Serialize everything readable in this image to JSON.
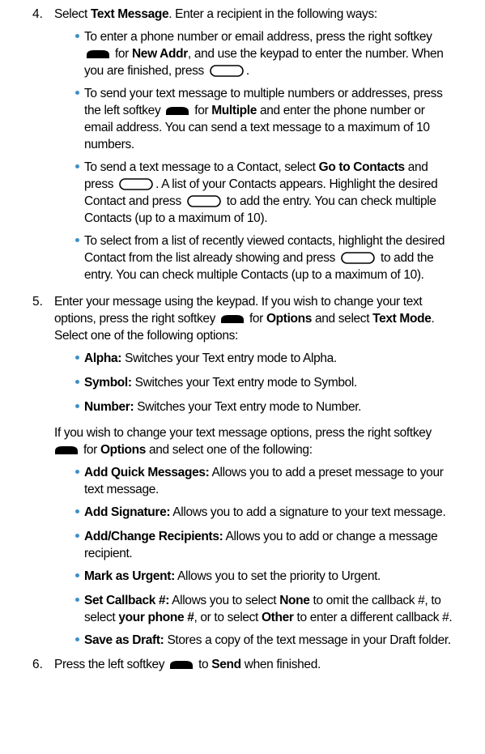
{
  "steps": {
    "s4": {
      "number": "4.",
      "l1a": "Select ",
      "l1b": "Text Message",
      "l1c": ". Enter a recipient in the following ways:"
    },
    "s5": {
      "number": "5.",
      "l1": "Enter your message using the keypad. If you wish to change your text",
      "l2a": "options, press the right softkey ",
      "l2b": " for ",
      "l2c": "Options",
      "l2d": " and select ",
      "l2e": "Text Mode",
      "l2f": ".",
      "l3": "Select one of the following options:",
      "p1": "If you wish to change your text message options, press the right softkey",
      "p2a": " for ",
      "p2b": "Options",
      "p2c": " and select one of the following:"
    },
    "s6": {
      "number": "6.",
      "a": "Press the left softkey ",
      "b": " to ",
      "c": "Send",
      "d": " when finished."
    }
  },
  "bullets4": {
    "b1": {
      "l1": "To enter a phone number or email address, press the right softkey",
      "l2a": " for ",
      "l2b": "New Addr",
      "l2c": ", and use the keypad to enter the number. When",
      "l3a": "you are finished, press ",
      "l3b": "."
    },
    "b2": {
      "l1": "To send your text message to multiple numbers or addresses, press",
      "l2a": "the left softkey ",
      "l2b": " for ",
      "l2c": "Multiple",
      "l2d": " and enter the phone number or",
      "l3": "email address. You can send a text message to a maximum of 10",
      "l4": "numbers."
    },
    "b3": {
      "l1a": "To send a text message to a Contact, select ",
      "l1b": "Go to Contacts",
      "l1c": " and",
      "l2a": "press ",
      "l2b": ". A list of your Contacts appears. Highlight the desired",
      "l3a": "Contact and press ",
      "l3b": " to add the entry. You can check multiple",
      "l4": "Contacts (up to a maximum of 10)."
    },
    "b4": {
      "l1": "To select from a list of recently viewed contacts, highlight the desired",
      "l2a": "Contact from the list already showing and press ",
      "l2b": " to add the",
      "l3": "entry. You can check multiple Contacts (up to a maximum of 10)."
    }
  },
  "modes": [
    {
      "term": "Alpha:",
      "desc": " Switches your Text entry mode to Alpha."
    },
    {
      "term": "Symbol:",
      "desc": " Switches your Text entry mode to Symbol."
    },
    {
      "term": "Number:",
      "desc": " Switches your Text entry mode to Number."
    }
  ],
  "options": {
    "o1": {
      "term": "Add Quick Messages:",
      "l1": " Allows you to add a preset message to your",
      "l2": "text message."
    },
    "o2": {
      "term": "Add Signature:",
      "l1": " Allows you to add a signature to your text message."
    },
    "o3": {
      "term": "Add/Change Recipients:",
      "l1": " Allows you to add or change a message",
      "l2": "recipient."
    },
    "o4": {
      "term": "Mark as Urgent:",
      "l1": " Allows you to set the priority to Urgent."
    },
    "o5": {
      "term": "Set Callback #:",
      "l1a": " Allows you to select ",
      "l1b": "None",
      "l1c": " to omit the callback #, to",
      "l2a": "select ",
      "l2b": "your phone #",
      "l2c": ", or to select ",
      "l2d": "Other",
      "l2e": " to enter a different callback #."
    },
    "o6": {
      "term": "Save as Draft:",
      "l1": " Stores a copy of the text message in your Draft folder."
    }
  },
  "colors": {
    "bullet": "#3d8fc8",
    "text": "#000000",
    "icon": "#000000"
  },
  "icons": {
    "softkey": "softkey-icon",
    "ok": "ok-key-icon"
  }
}
